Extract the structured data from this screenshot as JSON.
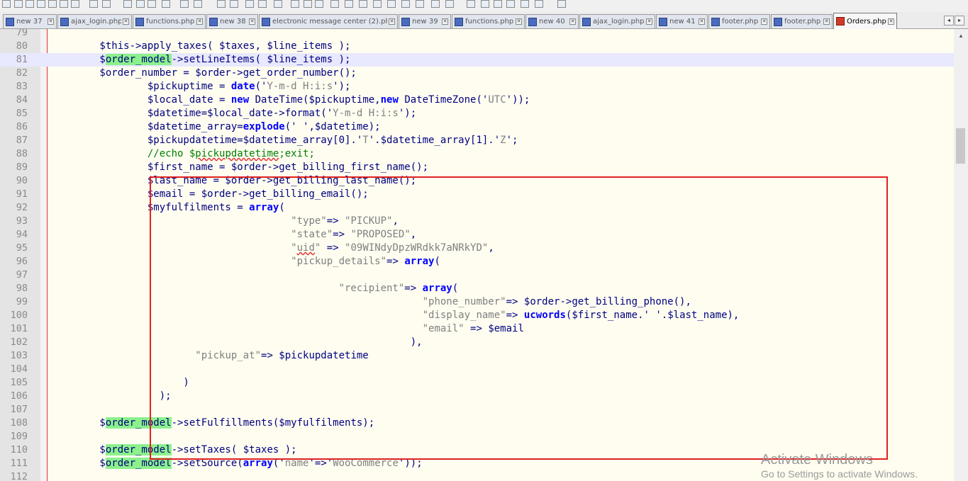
{
  "tabs": [
    {
      "label": "new 37",
      "active": false
    },
    {
      "label": "ajax_login.php",
      "active": false
    },
    {
      "label": "functions.php",
      "active": false
    },
    {
      "label": "new 38",
      "active": false
    },
    {
      "label": "electronic message center (2).php",
      "active": false
    },
    {
      "label": "new 39",
      "active": false
    },
    {
      "label": "functions.php",
      "active": false
    },
    {
      "label": "new 40",
      "active": false
    },
    {
      "label": "ajax_login.php",
      "active": false
    },
    {
      "label": "new 41",
      "active": false
    },
    {
      "label": "footer.php",
      "active": false
    },
    {
      "label": "footer.php",
      "active": false
    },
    {
      "label": "Orders.php",
      "active": true
    }
  ],
  "tab_close_glyph": "✕",
  "tab_nav": {
    "prev": "◂",
    "next": "▸"
  },
  "current_line": "81",
  "lines": [
    {
      "n": "79",
      "segs": []
    },
    {
      "n": "80",
      "segs": [
        [
          "        $this->apply_taxes( $taxes, $line_items );",
          ""
        ]
      ]
    },
    {
      "n": "81",
      "segs": [
        [
          "        $",
          ""
        ],
        [
          "order_model",
          "hl"
        ],
        [
          "->setLineItems( $line_items );",
          ""
        ]
      ]
    },
    {
      "n": "82",
      "segs": [
        [
          "        $order_number = $order->get_order_number();",
          ""
        ]
      ]
    },
    {
      "n": "83",
      "segs": [
        [
          "                $pickuptime = ",
          ""
        ],
        [
          "date",
          "kw"
        ],
        [
          "('",
          ""
        ],
        [
          "Y-m-d H:i:s",
          "str"
        ],
        [
          "');",
          ""
        ]
      ]
    },
    {
      "n": "84",
      "segs": [
        [
          "                $local_date = ",
          ""
        ],
        [
          "new",
          "kw"
        ],
        [
          " DateTime($pickuptime,",
          ""
        ],
        [
          "new",
          "kw"
        ],
        [
          " DateTimeZone('",
          ""
        ],
        [
          "UTC",
          "str"
        ],
        [
          "'));",
          ""
        ]
      ]
    },
    {
      "n": "85",
      "segs": [
        [
          "                $datetime=$local_date->format('",
          ""
        ],
        [
          "Y-m-d H:i:s",
          "str"
        ],
        [
          "');",
          ""
        ]
      ]
    },
    {
      "n": "86",
      "segs": [
        [
          "                $datetime_array=",
          ""
        ],
        [
          "explode",
          "kw"
        ],
        [
          "(' ',$datetime);",
          ""
        ]
      ]
    },
    {
      "n": "87",
      "segs": [
        [
          "                $pickupdatetime=$datetime_array[0].'",
          ""
        ],
        [
          "T",
          "str"
        ],
        [
          "'.$datetime_array[1].'",
          ""
        ],
        [
          "Z",
          "str"
        ],
        [
          "';",
          ""
        ]
      ]
    },
    {
      "n": "88",
      "segs": [
        [
          "                //echo $",
          "cmt"
        ],
        [
          "pickupdatetime",
          "cmt squig"
        ],
        [
          ";exit;",
          "cmt"
        ]
      ]
    },
    {
      "n": "89",
      "segs": [
        [
          "                $first_name = $order->get_billing_first_name();",
          ""
        ]
      ]
    },
    {
      "n": "90",
      "segs": [
        [
          "                $last_name = $order->get_billing_last_name();",
          ""
        ]
      ]
    },
    {
      "n": "91",
      "segs": [
        [
          "                $email = $order->get_billing_email();",
          ""
        ]
      ]
    },
    {
      "n": "92",
      "segs": [
        [
          "                $myfulfilments = ",
          ""
        ],
        [
          "array",
          "kw"
        ],
        [
          "(",
          ""
        ]
      ]
    },
    {
      "n": "93",
      "segs": [
        [
          "                                        ",
          ""
        ],
        [
          "\"type\"",
          "str"
        ],
        [
          "=> ",
          ""
        ],
        [
          "\"PICKUP\"",
          "str"
        ],
        [
          ",",
          ""
        ]
      ]
    },
    {
      "n": "94",
      "segs": [
        [
          "                                        ",
          ""
        ],
        [
          "\"state\"",
          "str"
        ],
        [
          "=> ",
          ""
        ],
        [
          "\"PROPOSED\"",
          "str"
        ],
        [
          ",",
          ""
        ]
      ]
    },
    {
      "n": "95",
      "segs": [
        [
          "                                        ",
          ""
        ],
        [
          "\"",
          "str"
        ],
        [
          "uid",
          "str squig"
        ],
        [
          "\"",
          "str"
        ],
        [
          " => ",
          ""
        ],
        [
          "\"09WINdyDpzWRdkk7aNRkYD\"",
          "str"
        ],
        [
          ",",
          ""
        ]
      ]
    },
    {
      "n": "96",
      "segs": [
        [
          "                                        ",
          ""
        ],
        [
          "\"pickup_details\"",
          "str"
        ],
        [
          "=> ",
          ""
        ],
        [
          "array",
          "kw"
        ],
        [
          "(",
          ""
        ]
      ]
    },
    {
      "n": "97",
      "segs": []
    },
    {
      "n": "98",
      "segs": [
        [
          "                                                ",
          ""
        ],
        [
          "\"recipient\"",
          "str"
        ],
        [
          "=> ",
          ""
        ],
        [
          "array",
          "kw"
        ],
        [
          "(",
          ""
        ]
      ]
    },
    {
      "n": "99",
      "segs": [
        [
          "                                                              ",
          ""
        ],
        [
          "\"phone_number\"",
          "str"
        ],
        [
          "=> $order->get_billing_phone(),",
          ""
        ]
      ]
    },
    {
      "n": "100",
      "segs": [
        [
          "                                                              ",
          ""
        ],
        [
          "\"display_name\"",
          "str"
        ],
        [
          "=> ",
          ""
        ],
        [
          "ucwords",
          "kw"
        ],
        [
          "($first_name.' '.$last_name),",
          ""
        ]
      ]
    },
    {
      "n": "101",
      "segs": [
        [
          "                                                              ",
          ""
        ],
        [
          "\"email\"",
          "str"
        ],
        [
          " => $email",
          ""
        ]
      ]
    },
    {
      "n": "102",
      "segs": [
        [
          "                                                            ),",
          ""
        ]
      ]
    },
    {
      "n": "103",
      "segs": [
        [
          "                        ",
          ""
        ],
        [
          "\"pickup_at\"",
          "str"
        ],
        [
          "=> $pickupdatetime",
          ""
        ]
      ]
    },
    {
      "n": "104",
      "segs": []
    },
    {
      "n": "105",
      "segs": [
        [
          "                      )",
          ""
        ]
      ]
    },
    {
      "n": "106",
      "segs": [
        [
          "                  );",
          ""
        ]
      ]
    },
    {
      "n": "107",
      "segs": []
    },
    {
      "n": "108",
      "segs": [
        [
          "        $",
          ""
        ],
        [
          "order_model",
          "hl"
        ],
        [
          "->setFulfillments($myfulfilments);",
          ""
        ]
      ]
    },
    {
      "n": "109",
      "segs": []
    },
    {
      "n": "110",
      "segs": [
        [
          "        $",
          ""
        ],
        [
          "order_model",
          "hl"
        ],
        [
          "->setTaxes( $taxes );",
          ""
        ]
      ]
    },
    {
      "n": "111",
      "segs": [
        [
          "        $",
          ""
        ],
        [
          "order_model",
          "hl"
        ],
        [
          "->setSource(",
          ""
        ],
        [
          "array",
          "kw"
        ],
        [
          "('",
          ""
        ],
        [
          "name",
          "str"
        ],
        [
          "'=>'",
          ""
        ],
        [
          "WooCommerce",
          "str"
        ],
        [
          "'));",
          ""
        ]
      ]
    },
    {
      "n": "112",
      "segs": []
    }
  ],
  "scrollbar": {
    "up_glyph": "▴"
  },
  "watermark": {
    "title": "Activate Windows",
    "subtitle": "Go to Settings to activate Windows."
  }
}
